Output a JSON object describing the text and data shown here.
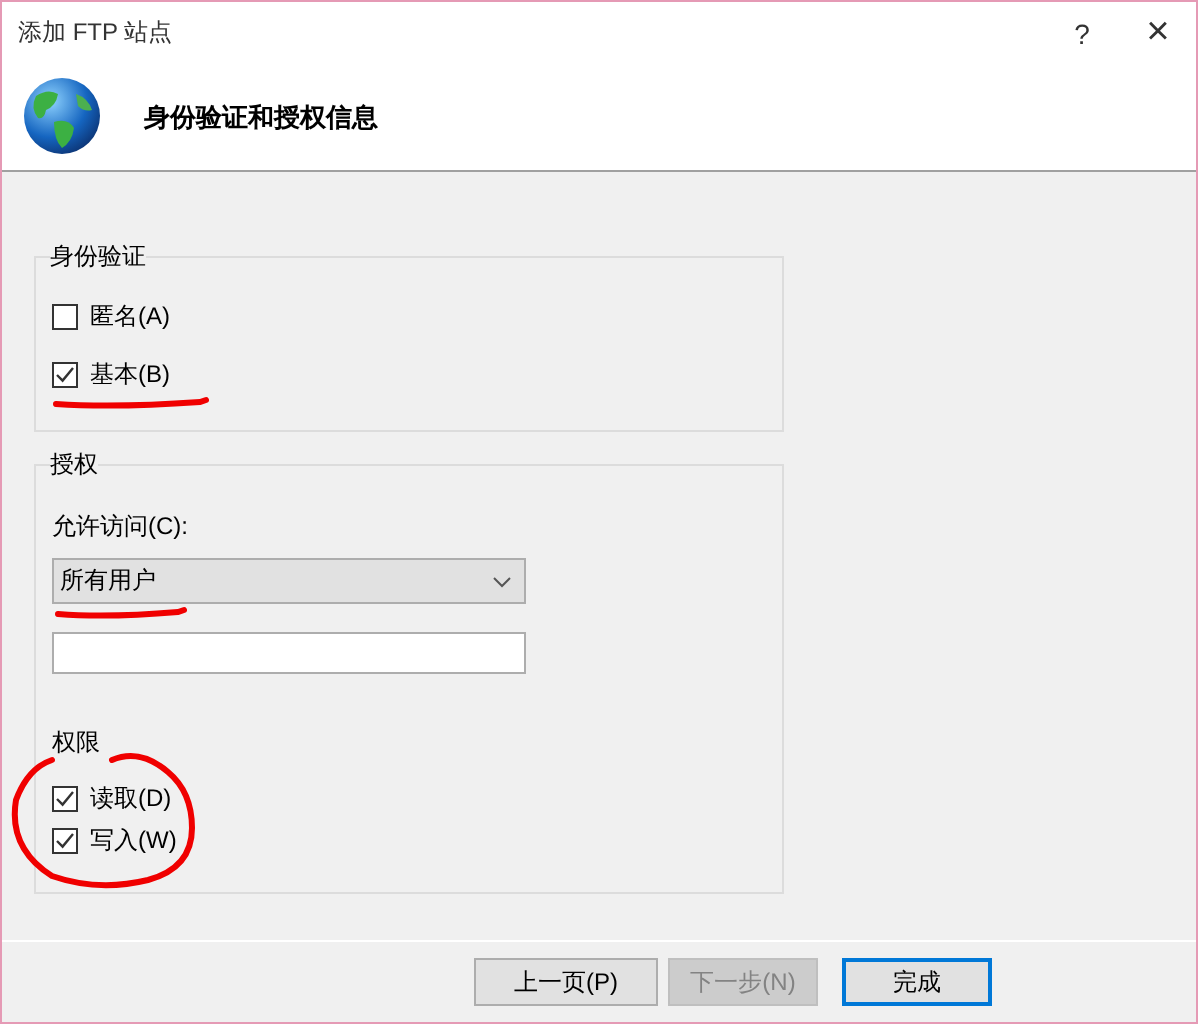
{
  "window": {
    "title": "添加 FTP 站点",
    "help": "?",
    "close": "×"
  },
  "header": {
    "title": "身份验证和授权信息"
  },
  "authentication": {
    "title": "身份验证",
    "options": [
      {
        "label": "匿名(A)",
        "checked": false
      },
      {
        "label": "基本(B)",
        "checked": true,
        "underlined": true
      }
    ]
  },
  "authorization": {
    "title": "授权",
    "access_label": "允许访问(C):",
    "access_value": "所有用户",
    "access_underlined": true,
    "permissions": {
      "title": "权限",
      "circled": true,
      "options": [
        {
          "label": "读取(D)",
          "checked": true
        },
        {
          "label": "写入(W)",
          "checked": true
        }
      ]
    }
  },
  "buttons": [
    {
      "label": "上一页(P)",
      "disabled": false,
      "default": false
    },
    {
      "label": "下一步(N)",
      "disabled": true,
      "default": false
    },
    {
      "label": "完成",
      "disabled": false,
      "default": true
    }
  ]
}
